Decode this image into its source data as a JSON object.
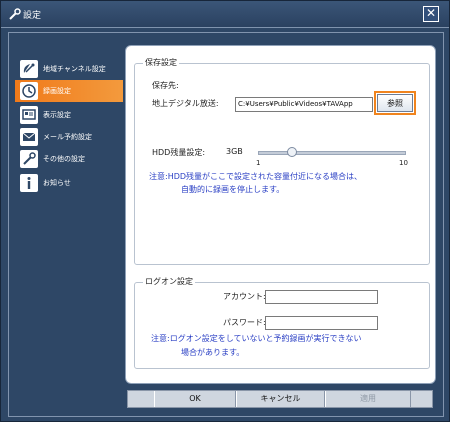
{
  "window": {
    "title": "設定"
  },
  "sidebar": {
    "items": [
      {
        "label": "地域チャンネル設定",
        "icon": "satellite-dish-icon",
        "active": false
      },
      {
        "label": "録画設定",
        "icon": "clock-icon",
        "active": true
      },
      {
        "label": "表示設定",
        "icon": "display-icon",
        "active": false
      },
      {
        "label": "メール予約設定",
        "icon": "mail-icon",
        "active": false
      },
      {
        "label": "その他の設定",
        "icon": "wrench-icon",
        "active": false
      },
      {
        "label": "お知らせ",
        "icon": "info-icon",
        "active": false
      }
    ]
  },
  "save": {
    "legend": "保存設定",
    "dest_label": "保存先:",
    "terrestrial_label": "地上デジタル放送:",
    "path_value": "C:¥Users¥Public¥Videos¥TAVApp",
    "browse_label": "参照",
    "hdd_label": "HDD残量設定:",
    "hdd_value": "3GB",
    "slider_min": "1",
    "slider_max": "10",
    "slider_level": 3,
    "note_line1": "注意:HDD残量がここで設定された容量付近になる場合は、",
    "note_line2": "自動的に録画を停止します。"
  },
  "logon": {
    "legend": "ログオン設定",
    "account_label": "アカウント:",
    "account_value": "",
    "password_label": "パスワード:",
    "password_value": "",
    "note_line1": "注意:ログオン設定をしていないと予約録画が実行できない",
    "note_line2": "場合があります。"
  },
  "buttons": {
    "ok": "OK",
    "cancel": "キャンセル",
    "apply": "適用"
  },
  "colors": {
    "accent": "#f07a1a",
    "background": "#2e4766",
    "note": "#2a3fc4"
  }
}
